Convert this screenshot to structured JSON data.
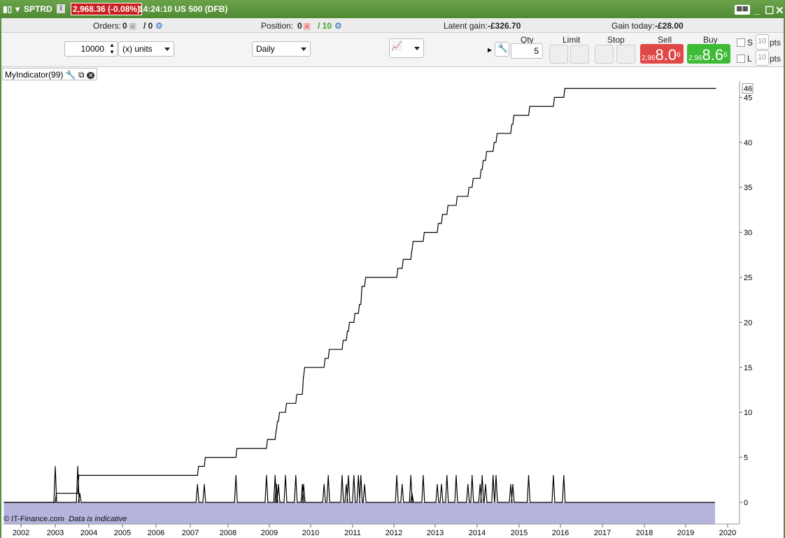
{
  "window": {
    "symbol": "SPTRD",
    "price_change": "2,968.36 (-0.08%)",
    "time_instrument": "14:24:10 US 500 (DFB)",
    "icons": [
      "candlestick-icon",
      "info-icon",
      "keyboard-icon",
      "minimize-icon",
      "maximize-icon",
      "close-icon"
    ]
  },
  "info": {
    "orders_label": "Orders:",
    "orders_value": "0",
    "orders_total": "/ 0",
    "position_label": "Position:",
    "position_value": "0",
    "position_total": "/ 10",
    "latent_label": "Latent gain:",
    "latent_value": "-£326.70",
    "gain_today_label": "Gain today:",
    "gain_today_value": "-£28.00"
  },
  "toolbar": {
    "amount": "10000",
    "units": "(x) units",
    "period": "Daily",
    "qty_label": "Qty",
    "qty": "5",
    "limit_label": "Limit",
    "stop_label": "Stop",
    "sell_label": "Sell",
    "buy_label": "Buy",
    "sell_prefix": "2,96",
    "sell_big": "8.0",
    "sell_sup": "6",
    "buy_prefix": "2,96",
    "buy_big": "8.6",
    "buy_sup": "6",
    "s_label": "S",
    "l_label": "L",
    "s_pts": "10",
    "l_pts": "10",
    "pts": "pts"
  },
  "colors": {
    "sell": "#e04848",
    "buy": "#3dbb34",
    "area": "#b4b4dc",
    "title_bar": "#5a9a3a"
  },
  "indicator": {
    "name": "MyIndicator(99)",
    "copyright": "© IT-Finance.com",
    "disclaimer": "Data is indicative"
  },
  "chart_data": {
    "type": "line",
    "x_ticks": [
      "2002",
      "2003",
      "2004",
      "2005",
      "2006",
      "2007",
      "2008",
      "2009",
      "2010",
      "2011",
      "2012",
      "2013",
      "2014",
      "2015",
      "2016",
      "2017",
      "2018",
      "2019",
      "2020"
    ],
    "y_ticks": [
      0,
      5,
      10,
      15,
      20,
      25,
      30,
      35,
      40,
      45
    ],
    "ylim": [
      -2.4,
      47
    ],
    "last_value": "46",
    "step_series": [
      [
        2001.5,
        0
      ],
      [
        2003.0,
        1
      ],
      [
        2003.67,
        3
      ],
      [
        2007.19,
        4
      ],
      [
        2007.37,
        5
      ],
      [
        2008.19,
        6
      ],
      [
        2008.93,
        7
      ],
      [
        2009.14,
        8
      ],
      [
        2009.17,
        9
      ],
      [
        2009.22,
        10
      ],
      [
        2009.39,
        11
      ],
      [
        2009.64,
        12
      ],
      [
        2009.8,
        14
      ],
      [
        2009.83,
        15
      ],
      [
        2010.32,
        16
      ],
      [
        2010.42,
        17
      ],
      [
        2010.75,
        18
      ],
      [
        2010.85,
        19
      ],
      [
        2010.9,
        20
      ],
      [
        2011.03,
        21
      ],
      [
        2011.14,
        22
      ],
      [
        2011.2,
        24
      ],
      [
        2011.29,
        25
      ],
      [
        2012.07,
        26
      ],
      [
        2012.2,
        27
      ],
      [
        2012.41,
        28
      ],
      [
        2012.44,
        29
      ],
      [
        2012.71,
        30
      ],
      [
        2013.05,
        31
      ],
      [
        2013.15,
        32
      ],
      [
        2013.28,
        33
      ],
      [
        2013.5,
        34
      ],
      [
        2013.78,
        35
      ],
      [
        2013.88,
        36
      ],
      [
        2014.07,
        37
      ],
      [
        2014.12,
        38
      ],
      [
        2014.2,
        39
      ],
      [
        2014.38,
        40
      ],
      [
        2014.45,
        41
      ],
      [
        2014.8,
        42
      ],
      [
        2014.85,
        43
      ],
      [
        2015.23,
        44
      ],
      [
        2015.83,
        45
      ],
      [
        2016.08,
        46
      ],
      [
        2019.7,
        46
      ]
    ],
    "spike_series": [
      [
        2003.0,
        4
      ],
      [
        2003.67,
        4
      ],
      [
        2003.73,
        1
      ],
      [
        2007.19,
        2
      ],
      [
        2007.37,
        2
      ],
      [
        2008.19,
        3
      ],
      [
        2008.93,
        3
      ],
      [
        2009.14,
        3
      ],
      [
        2009.17,
        2
      ],
      [
        2009.22,
        2
      ],
      [
        2009.39,
        3
      ],
      [
        2009.64,
        3
      ],
      [
        2009.8,
        2
      ],
      [
        2009.83,
        2
      ],
      [
        2010.32,
        2
      ],
      [
        2010.42,
        3
      ],
      [
        2010.75,
        3
      ],
      [
        2010.85,
        2
      ],
      [
        2010.9,
        3
      ],
      [
        2011.03,
        3
      ],
      [
        2011.14,
        3
      ],
      [
        2011.2,
        3
      ],
      [
        2011.29,
        2
      ],
      [
        2012.07,
        3
      ],
      [
        2012.2,
        2
      ],
      [
        2012.41,
        3
      ],
      [
        2012.44,
        1
      ],
      [
        2012.71,
        3
      ],
      [
        2013.05,
        2
      ],
      [
        2013.15,
        2
      ],
      [
        2013.28,
        3
      ],
      [
        2013.5,
        3
      ],
      [
        2013.78,
        2
      ],
      [
        2013.88,
        3
      ],
      [
        2014.07,
        2
      ],
      [
        2014.12,
        3
      ],
      [
        2014.2,
        2
      ],
      [
        2014.38,
        3
      ],
      [
        2014.45,
        3
      ],
      [
        2014.8,
        2
      ],
      [
        2014.85,
        2
      ],
      [
        2015.23,
        3
      ],
      [
        2015.83,
        3
      ],
      [
        2016.08,
        3
      ]
    ],
    "x_range": [
      2001.5,
      2019.7
    ]
  }
}
